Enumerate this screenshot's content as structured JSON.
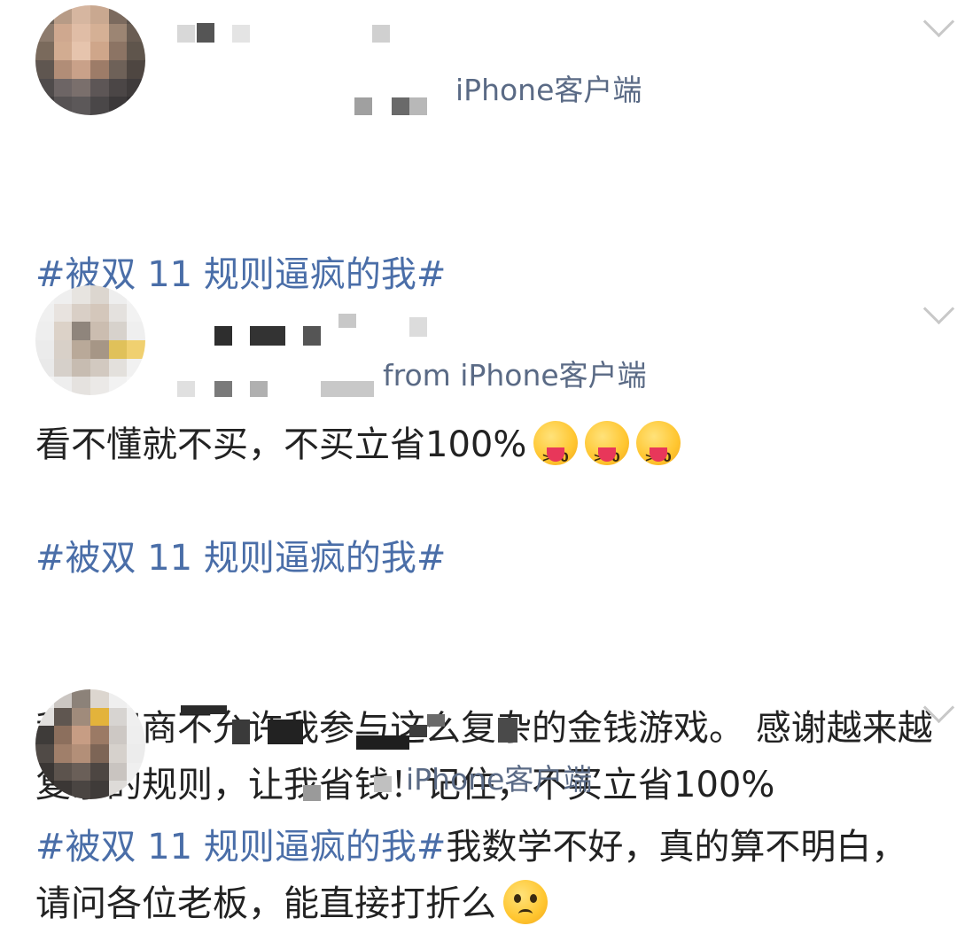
{
  "posts": [
    {
      "source": "iPhone客户端",
      "hashtag": "#被双 11 规则逼疯的我#",
      "body_after_tag": "",
      "body": "看不懂就不买，不买立省100%",
      "emojis": [
        "tongue-out-emoji",
        "tongue-out-emoji",
        "tongue-out-emoji"
      ]
    },
    {
      "source": "from iPhone客户端",
      "hashtag": "#被双 11 规则逼疯的我#",
      "body_after_tag": "",
      "body": "我的智商不允许我参与这么复杂的金钱游戏。 感谢越来越复杂的规则，让我省钱！记住，不买立省100%",
      "emojis": []
    },
    {
      "source": "iPhone客户端",
      "hashtag": "#被双 11 规则逼疯的我#",
      "body_after_tag": "我数学不好，真的算不明白，请问各位老板，能直接打折么",
      "body": "",
      "emojis": [
        "sad-emoji"
      ]
    }
  ],
  "colors": {
    "hashtag": "#4a6ea8",
    "source": "#5a6a85",
    "text": "#222222"
  }
}
